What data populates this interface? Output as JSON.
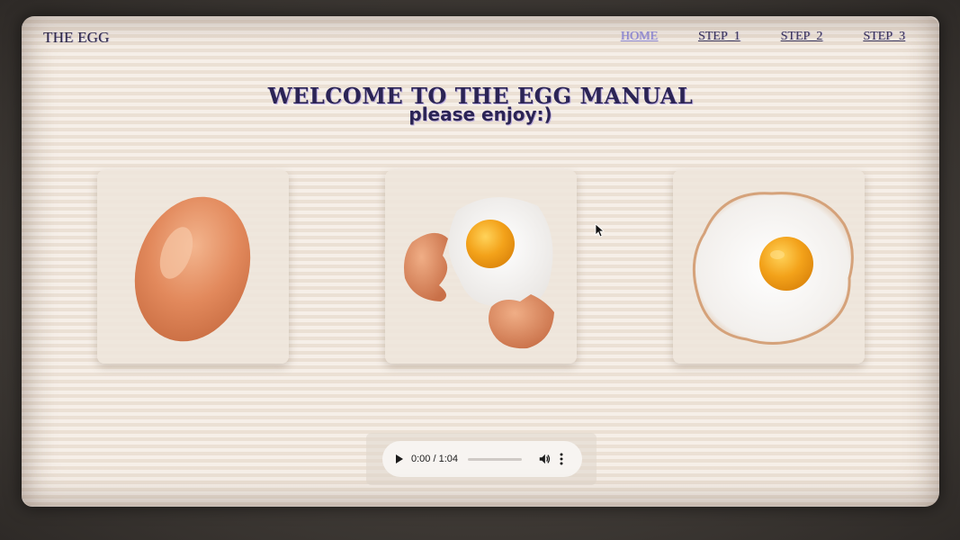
{
  "header": {
    "brand": "THE EGG",
    "nav": [
      {
        "label": "HOME",
        "active": true
      },
      {
        "label": "STEP_1",
        "active": false
      },
      {
        "label": "STEP_2",
        "active": false
      },
      {
        "label": "STEP_3",
        "active": false
      }
    ]
  },
  "main": {
    "title": "WELCOME TO THE EGG MANUAL",
    "subtitle": "please enjoy:)"
  },
  "cards": [
    {
      "image": "whole-egg"
    },
    {
      "image": "cracked-egg"
    },
    {
      "image": "fried-egg"
    }
  ],
  "audio": {
    "time": "0:00 / 1:04",
    "progress_fraction": 0
  },
  "colors": {
    "page_background": "#f1e7dc",
    "text_dark": "#2b2455",
    "nav_active": "#8f8ad8",
    "eggshell": "#e08a5e",
    "yolk": "#f3a21a"
  }
}
